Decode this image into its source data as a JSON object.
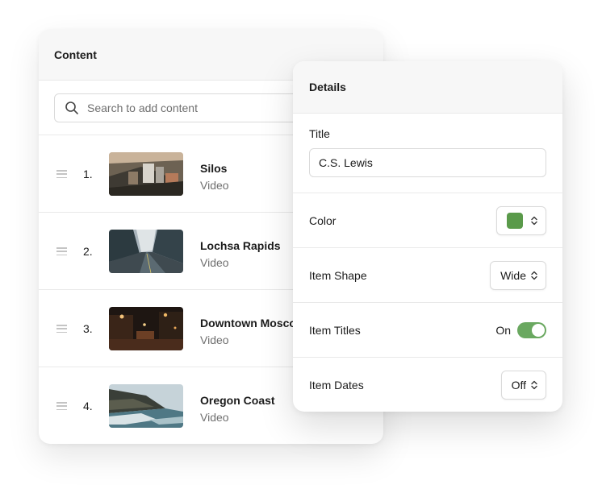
{
  "content": {
    "title": "Content",
    "search_placeholder": "Search to add content",
    "items": [
      {
        "num": "1.",
        "title": "Silos",
        "type": "Video",
        "thumb": "silos-aerial"
      },
      {
        "num": "2.",
        "title": "Lochsa Rapids",
        "type": "Video",
        "thumb": "mountain-road"
      },
      {
        "num": "3.",
        "title": "Downtown Moscow",
        "type": "Video",
        "thumb": "night-street"
      },
      {
        "num": "4.",
        "title": "Oregon Coast",
        "type": "Video",
        "thumb": "coast-cliffs"
      }
    ]
  },
  "details": {
    "title": "Details",
    "title_label": "Title",
    "title_value": "C.S. Lewis",
    "color_label": "Color",
    "color_value": "#5a9a4a",
    "item_shape_label": "Item Shape",
    "item_shape_value": "Wide",
    "item_titles_label": "Item Titles",
    "item_titles_value": "On",
    "item_dates_label": "Item Dates",
    "item_dates_value": "Off"
  },
  "colors": {
    "accent_green": "#5a9a4a",
    "toggle_on": "#6aa860"
  },
  "icons": {
    "search": "search-icon",
    "drag": "drag-handle-icon",
    "select": "chevron-up-down-icon"
  }
}
